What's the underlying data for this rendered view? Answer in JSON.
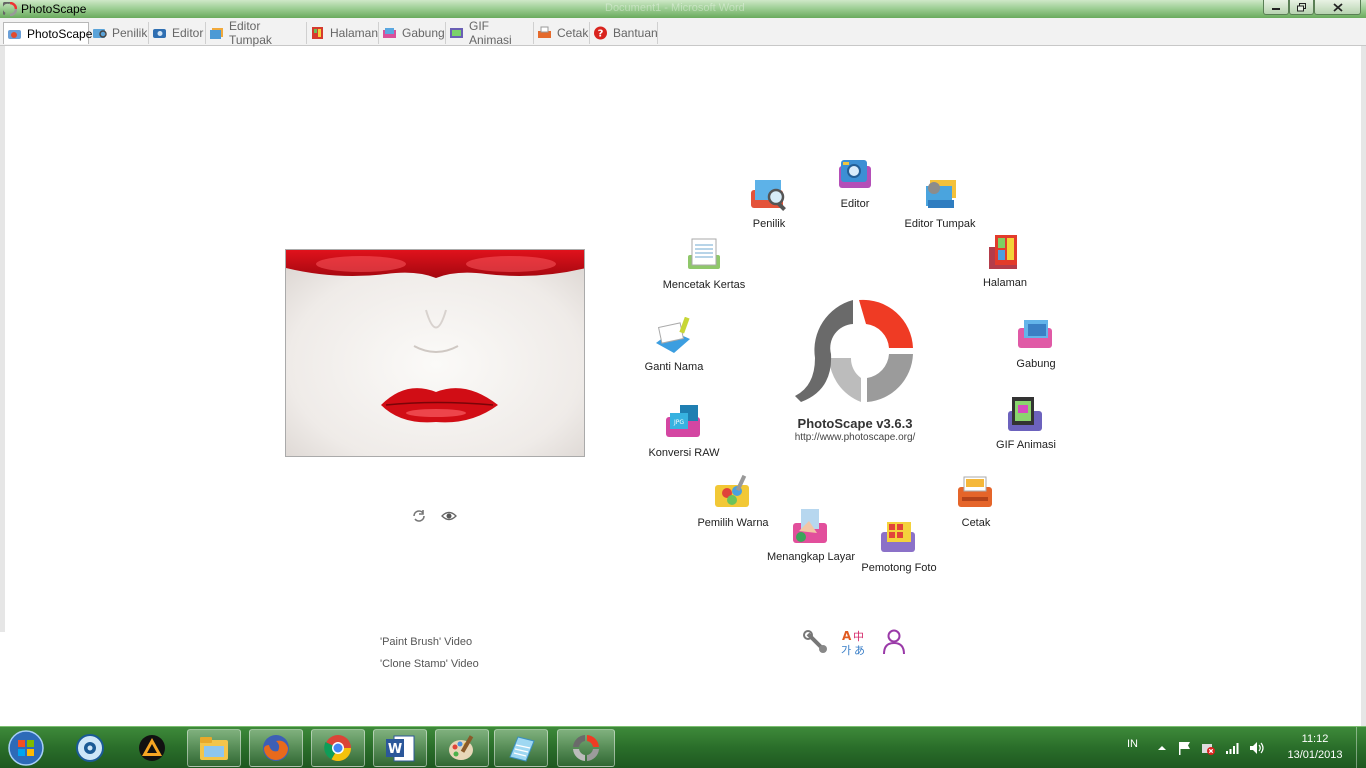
{
  "window": {
    "title": "PhotoScape",
    "background_title": "Document1 - Microsoft Word"
  },
  "tabs": [
    {
      "label": "PhotoScape",
      "icon": "photoscape-icon",
      "active": true
    },
    {
      "label": "Penilik",
      "icon": "viewer-icon"
    },
    {
      "label": "Editor",
      "icon": "editor-icon"
    },
    {
      "label": "Editor Tumpak",
      "icon": "batch-editor-icon"
    },
    {
      "label": "Halaman",
      "icon": "page-icon"
    },
    {
      "label": "Gabung",
      "icon": "combine-icon"
    },
    {
      "label": "GIF Animasi",
      "icon": "gif-icon"
    },
    {
      "label": "Cetak",
      "icon": "print-icon"
    },
    {
      "label": "Bantuan",
      "icon": "help-icon"
    }
  ],
  "hub": {
    "version": "PhotoScape v3.6.3",
    "url": "http://www.photoscape.org/",
    "items": [
      {
        "label": "Editor",
        "icon": "editor-icon"
      },
      {
        "label": "Editor Tumpak",
        "icon": "batch-editor-icon"
      },
      {
        "label": "Halaman",
        "icon": "page-icon"
      },
      {
        "label": "Gabung",
        "icon": "combine-icon"
      },
      {
        "label": "GIF Animasi",
        "icon": "gif-icon"
      },
      {
        "label": "Cetak",
        "icon": "print-icon"
      },
      {
        "label": "Pemotong Foto",
        "icon": "splitter-icon"
      },
      {
        "label": "Menangkap Layar",
        "icon": "screen-capture-icon"
      },
      {
        "label": "Pemilih Warna",
        "icon": "color-picker-icon"
      },
      {
        "label": "Konversi RAW",
        "icon": "raw-converter-icon"
      },
      {
        "label": "Ganti Nama",
        "icon": "rename-icon"
      },
      {
        "label": "Mencetak Kertas",
        "icon": "paper-print-icon"
      },
      {
        "label": "Penilik",
        "icon": "viewer-icon"
      }
    ]
  },
  "promo": {
    "line1": "'Paint Brush' Video",
    "line2": "'Clone Stamp' Video"
  },
  "bottom_tools": [
    "settings-icon",
    "language-icon",
    "user-icon"
  ],
  "taskbar": {
    "apps": [
      "media-player-icon",
      "vlc-icon",
      "file-explorer-icon",
      "firefox-icon",
      "chrome-icon",
      "word-icon",
      "paint-icon",
      "notepad-icon",
      "photoscape-icon"
    ],
    "language": "IN",
    "time": "11:12",
    "date": "13/01/2013"
  }
}
